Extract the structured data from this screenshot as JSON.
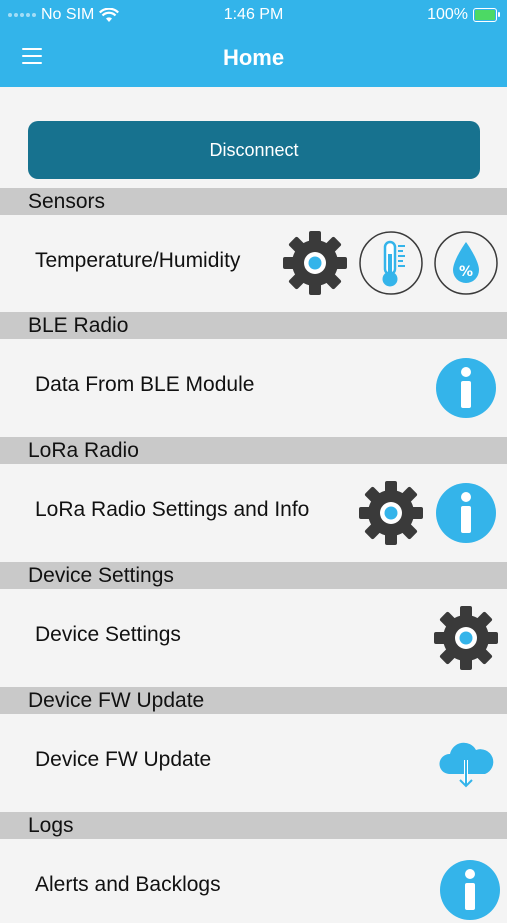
{
  "status_bar": {
    "carrier": "No SIM",
    "time": "1:46 PM",
    "battery": "100%",
    "battery_level": 1.0
  },
  "nav": {
    "title": "Home",
    "menu_icon": "hamburger-menu-icon"
  },
  "actions": {
    "disconnect_label": "Disconnect"
  },
  "colors": {
    "header": "#33b4ea",
    "button": "#17728f",
    "section": "#c9c9c9",
    "gear": "#3a3a3a",
    "info": "#34b4ea"
  },
  "sections": [
    {
      "title": "Sensors",
      "row_label": "Temperature/Humidity",
      "icons": [
        "gear-icon",
        "thermometer-icon",
        "humidity-drop-icon"
      ]
    },
    {
      "title": "BLE Radio",
      "row_label": "Data From BLE Module",
      "icons": [
        "info-icon"
      ]
    },
    {
      "title": "LoRa Radio",
      "row_label": "LoRa Radio Settings and Info",
      "icons": [
        "gear-icon",
        "info-icon"
      ]
    },
    {
      "title": "Device Settings",
      "row_label": "Device Settings",
      "icons": [
        "gear-icon"
      ]
    },
    {
      "title": "Device FW Update",
      "row_label": "Device FW Update",
      "icons": [
        "cloud-download-icon"
      ]
    },
    {
      "title": "Logs",
      "row_label": "Alerts and Backlogs",
      "icons": [
        "info-icon"
      ]
    }
  ]
}
